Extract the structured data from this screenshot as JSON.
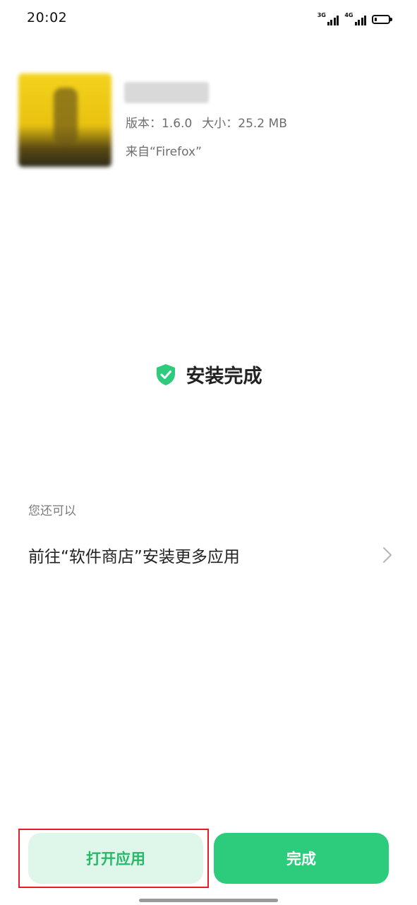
{
  "status_bar": {
    "time": "20:02",
    "net1": "3G",
    "net2": "4G",
    "battery_level": 0.15
  },
  "app": {
    "version_text": "版本：1.6.0",
    "size_text": "大小：25.2 MB",
    "source_text": "来自“Firefox”"
  },
  "status": {
    "complete_text": "安装完成",
    "icon": "shield-check-icon",
    "accent_color": "#2ccc7c"
  },
  "more": {
    "label": "您还可以",
    "store_link": "前往“软件商店”安装更多应用"
  },
  "buttons": {
    "open_label": "打开应用",
    "done_label": "完成"
  }
}
